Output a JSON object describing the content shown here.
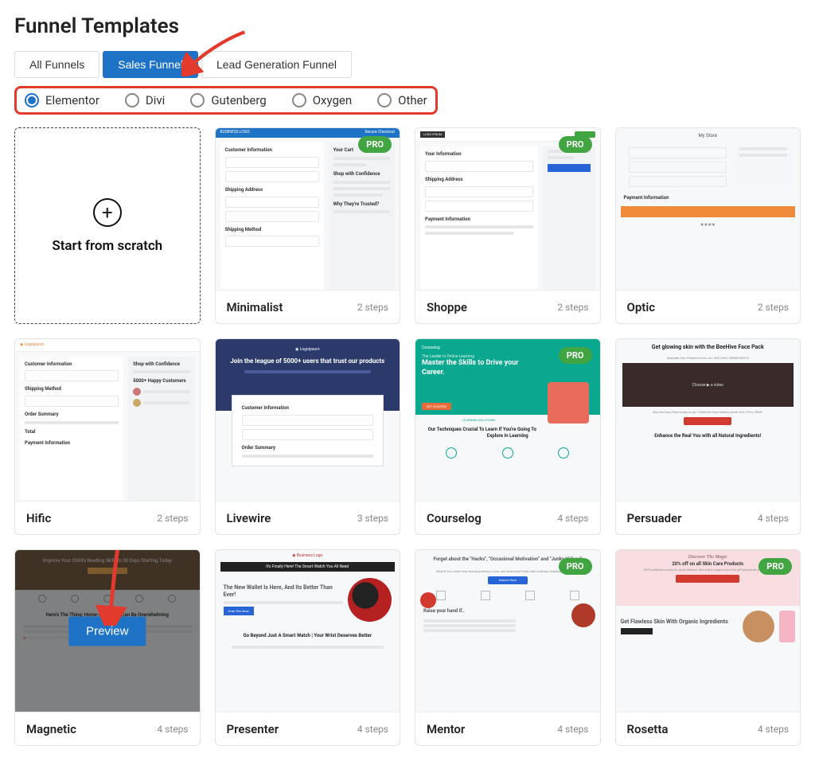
{
  "title": "Funnel Templates",
  "tabs": [
    {
      "label": "All Funnels",
      "active": false
    },
    {
      "label": "Sales Funnel",
      "active": true
    },
    {
      "label": "Lead Generation Funnel",
      "active": false
    }
  ],
  "builders": [
    {
      "label": "Elementor",
      "selected": true
    },
    {
      "label": "Divi",
      "selected": false
    },
    {
      "label": "Gutenberg",
      "selected": false
    },
    {
      "label": "Oxygen",
      "selected": false
    },
    {
      "label": "Other",
      "selected": false
    }
  ],
  "scratch_label": "Start from scratch",
  "preview_label": "Preview",
  "templates": [
    {
      "name": "Minimalist",
      "steps": "2 steps",
      "pro": true,
      "thumb": "minimalist"
    },
    {
      "name": "Shoppe",
      "steps": "2 steps",
      "pro": true,
      "thumb": "shoppe"
    },
    {
      "name": "Optic",
      "steps": "2 steps",
      "pro": false,
      "thumb": "optic"
    },
    {
      "name": "Hific",
      "steps": "2 steps",
      "pro": false,
      "thumb": "hific"
    },
    {
      "name": "Livewire",
      "steps": "3 steps",
      "pro": false,
      "thumb": "livewire"
    },
    {
      "name": "Courselog",
      "steps": "4 steps",
      "pro": true,
      "thumb": "courselog"
    },
    {
      "name": "Persuader",
      "steps": "4 steps",
      "pro": false,
      "thumb": "persuader"
    },
    {
      "name": "Magnetic",
      "steps": "4 steps",
      "pro": false,
      "thumb": "magnetic",
      "hover": true
    },
    {
      "name": "Presenter",
      "steps": "4 steps",
      "pro": false,
      "thumb": "presenter"
    },
    {
      "name": "Mentor",
      "steps": "4 steps",
      "pro": true,
      "thumb": "mentor"
    },
    {
      "name": "Rosetta",
      "steps": "4 steps",
      "pro": true,
      "thumb": "rosetta"
    }
  ],
  "pro_badge": "PRO",
  "thumb_text": {
    "minimalist_logo": "BUSINESS LOGO",
    "secure": "Secure Checkout",
    "cust_info": "Customer Information",
    "ship_addr": "Shipping Address",
    "ship_method": "Shipping Method",
    "your_cart": "Your Cart",
    "shop_conf": "Shop with Confidence",
    "why_trusted": "Why They're Trusted?",
    "shoppe_logo": "LOGO IPSUM",
    "your_info": "Your Information",
    "pay_info": "Payment Information",
    "optic_store": "My Store",
    "hific_logo": "Logoipsum",
    "order_summary": "Order Summary",
    "total": "Total",
    "happy_cust": "5000+ Happy Customers",
    "livewire_head": "Join the league of 5000+ users that trust our products",
    "courselog_logo": "Courselog",
    "courselog_head": "Master the Skills to Drive your Career.",
    "courselog_sub": "The Leader in Online Learning",
    "courselog_sub2": "Our Techniques Crucial To Learn If You're Going To Explore In Learning",
    "courselog_cat": "LEARNING SOLUTIONS",
    "persuader_head": "Get glowing skin with the BeeHive Face Pack",
    "persuader_vid": "Choose ▶ a video",
    "persuader_foot": "Enhance the Real You with all Natural Ingredients!",
    "magnetic_head": "Improve Your Child's Reading Skills in 30 Days Starting Today",
    "magnetic_sub": "Here's The Thing: Home-Schooling Can Be Overwhelming",
    "presenter_head": "The New Wallet Is Here, And Its Better Than Ever!",
    "presenter_top": "It's Finally Here! The Smart Watch You All Need",
    "presenter_btn": "Grab This Now",
    "presenter_foot": "Go Beyond Just A Smart Watch | Your Wrist Deserves Better",
    "mentor_head": "Forget about the \"Hacks\", \"Occasional Motivation\" and \"Junky Videos\"",
    "mentor_btn": "Explore Now",
    "mentor_raise": "Raise your hand if..",
    "rosetta_head": "Discover The Magic",
    "rosetta_off": "20% off on all Skin Care Products",
    "rosetta_foot": "Get Flawless Skin With Organic Ingredients"
  }
}
